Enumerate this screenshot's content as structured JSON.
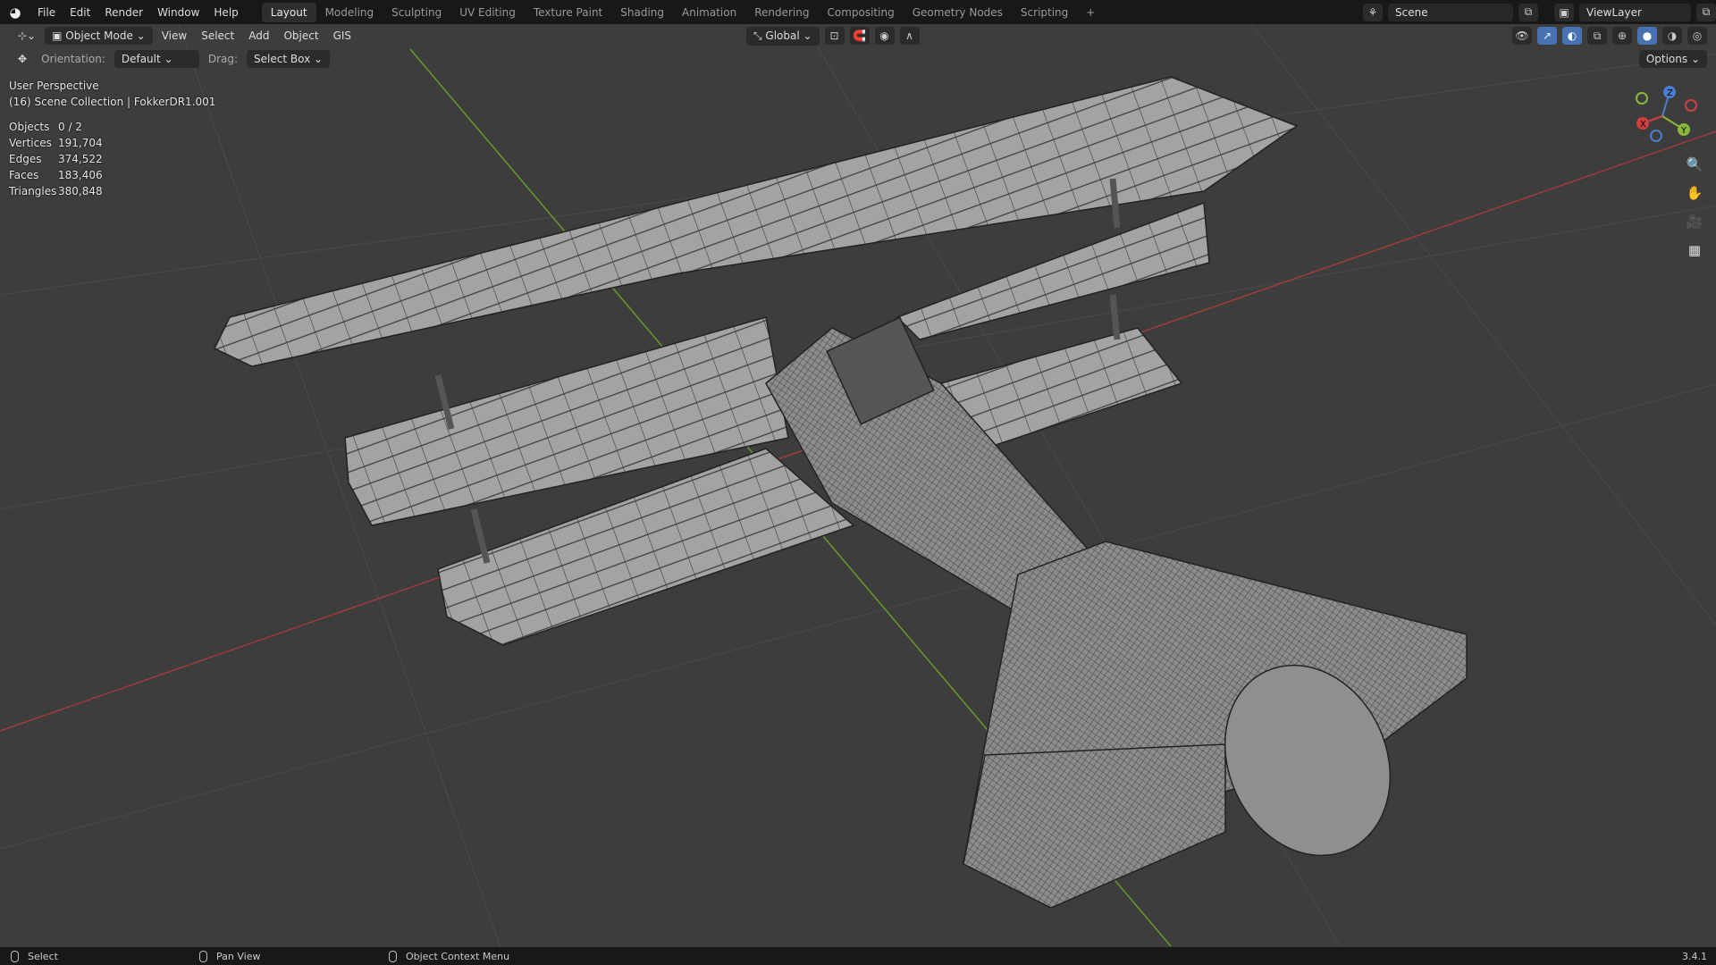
{
  "menu": [
    "File",
    "Edit",
    "Render",
    "Window",
    "Help"
  ],
  "workspaces": [
    "Layout",
    "Modeling",
    "Sculpting",
    "UV Editing",
    "Texture Paint",
    "Shading",
    "Animation",
    "Rendering",
    "Compositing",
    "Geometry Nodes",
    "Scripting",
    "+"
  ],
  "active_workspace": "Layout",
  "scene": "Scene",
  "view_layer": "ViewLayer",
  "header": {
    "mode": "Object Mode",
    "menus": [
      "View",
      "Select",
      "Add",
      "Object",
      "GIS"
    ],
    "transform_orientation": "Global"
  },
  "tool_settings": {
    "orientation_label": "Orientation:",
    "orientation_value": "Default",
    "drag_label": "Drag:",
    "drag_value": "Select Box",
    "options": "Options"
  },
  "overlay": {
    "view": "User Perspective",
    "collection": "(16) Scene Collection | FokkerDR1.001",
    "stats": [
      {
        "k": "Objects",
        "v": "0 / 2"
      },
      {
        "k": "Vertices",
        "v": "191,704"
      },
      {
        "k": "Edges",
        "v": "374,522"
      },
      {
        "k": "Faces",
        "v": "183,406"
      },
      {
        "k": "Triangles",
        "v": "380,848"
      }
    ]
  },
  "gizmo": {
    "z": "Z",
    "y": "Y",
    "x": "X"
  },
  "status": {
    "left": "Select",
    "middle": "Pan View",
    "right": "Object Context Menu",
    "version": "3.4.1"
  },
  "colors": {
    "x_axis": "#a33a3a",
    "y_axis": "#6a9a2a",
    "accent": "#4772b3"
  }
}
